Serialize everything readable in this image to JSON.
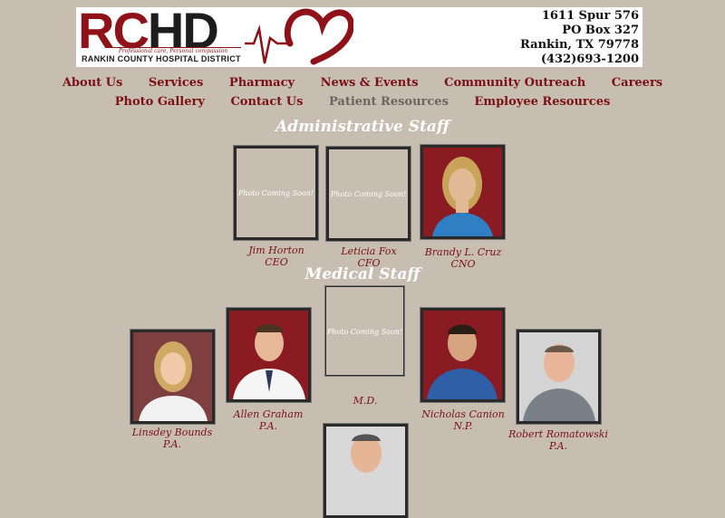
{
  "header": {
    "logo_text_1": "RC",
    "logo_text_2": "HD",
    "tagline": "Professional care, Personal compassion",
    "org_name": "RANKIN COUNTY HOSPITAL DISTRICT",
    "address_1": "1611 Spur 576",
    "address_2": "PO Box 327",
    "address_3": "Rankin, TX 79778",
    "phone": "(432)693-1200"
  },
  "nav": {
    "row1": [
      "About Us",
      "Services",
      "Pharmacy",
      "News & Events",
      "Community Outreach",
      "Careers"
    ],
    "row2": [
      "Photo Gallery",
      "Contact Us",
      "Patient Resources",
      "Employee Resources"
    ],
    "active": "Patient Resources"
  },
  "admin": {
    "title": "Administrative Staff",
    "staff": [
      {
        "name": "Jim Horton",
        "role": "CEO",
        "photo_text": "Photo Coming Soon!"
      },
      {
        "name": "Leticia Fox",
        "role": "CFO",
        "photo_text": "Photo Coming Soon!"
      },
      {
        "name": "Brandy L. Cruz",
        "role": "CNO"
      }
    ]
  },
  "medical": {
    "title": "Medical Staff",
    "staff": [
      {
        "name": "Linsdey Bounds",
        "role": "P.A."
      },
      {
        "name": "Allen Graham",
        "role": "P.A."
      },
      {
        "name": "",
        "role": "M.D.",
        "photo_text": "Photo Coming Soon!"
      },
      {
        "name": "Nicholas Canion",
        "role": "N.P."
      },
      {
        "name": "Robert Romatowski",
        "role": "P.A."
      }
    ]
  },
  "colors": {
    "background": "#c8bdb1",
    "brand_red": "#7a1116",
    "nav_active": "#6a6560"
  }
}
